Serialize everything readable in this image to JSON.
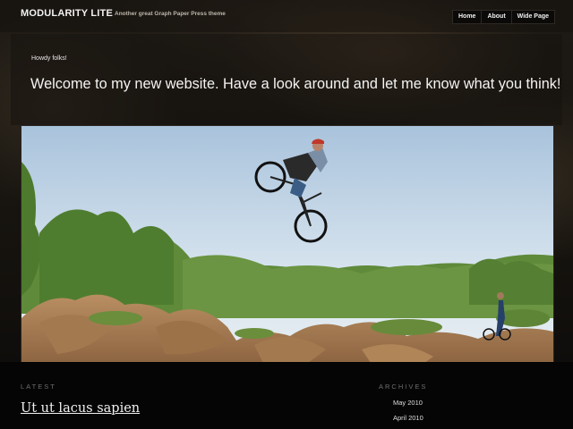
{
  "header": {
    "site_title": "MODULARITY LITE",
    "tagline": "Another great Graph Paper Press theme",
    "nav": [
      {
        "label": "Home"
      },
      {
        "label": "About"
      },
      {
        "label": "Wide Page"
      }
    ]
  },
  "intro": {
    "greeting": "Howdy folks!",
    "headline": "Welcome to my new website. Have a look around and let me know what you think!"
  },
  "hero_image": {
    "alt": "BMX rider jumping over dirt track"
  },
  "latest": {
    "heading": "LATEST",
    "post_title": "Ut ut lacus sapien"
  },
  "archives": {
    "heading": "ARCHIVES",
    "items": [
      {
        "label": "May 2010"
      },
      {
        "label": "April 2010"
      }
    ]
  }
}
